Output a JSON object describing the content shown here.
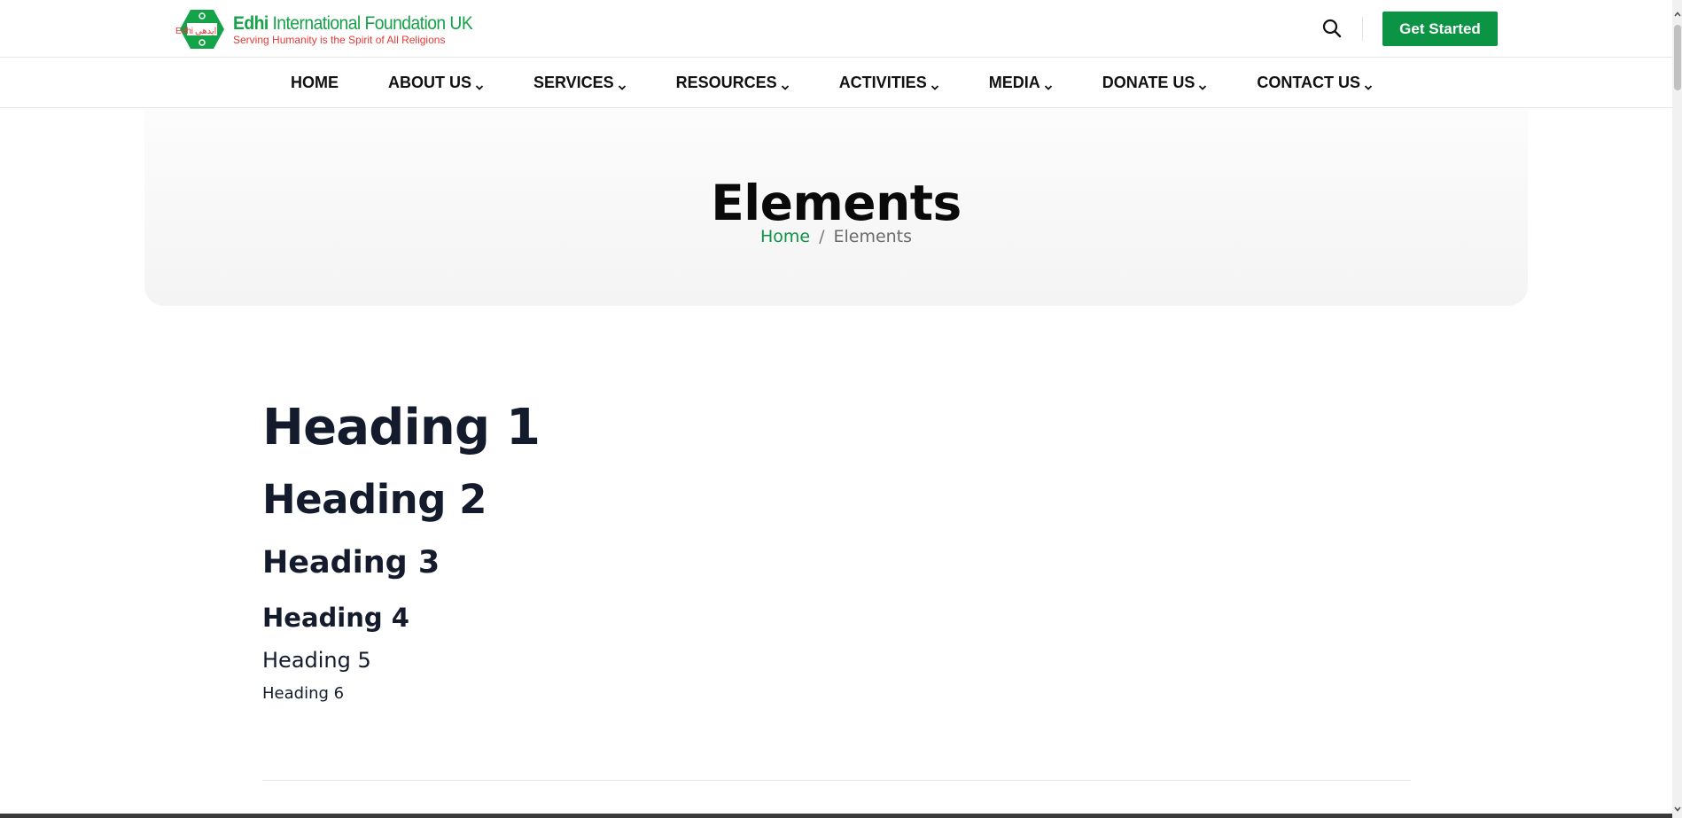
{
  "header": {
    "logo": {
      "mark_text": "Edhi ایدھی",
      "title_bold": "Edhi",
      "title_rest": " International Foundation UK",
      "tagline": "Serving Humanity is the Spirit of All Religions"
    },
    "search_icon": "search-icon",
    "cta_label": "Get Started"
  },
  "nav": {
    "items": [
      {
        "label": "HOME",
        "has_dropdown": false
      },
      {
        "label": "ABOUT US",
        "has_dropdown": true
      },
      {
        "label": "SERVICES",
        "has_dropdown": true
      },
      {
        "label": "RESOURCES",
        "has_dropdown": true
      },
      {
        "label": "ACTIVITIES",
        "has_dropdown": true
      },
      {
        "label": "MEDIA",
        "has_dropdown": true
      },
      {
        "label": "DONATE US",
        "has_dropdown": true
      },
      {
        "label": "CONTACT US",
        "has_dropdown": true
      }
    ]
  },
  "hero": {
    "title": "Elements",
    "breadcrumb": {
      "home": "Home",
      "separator": "/",
      "current": "Elements"
    }
  },
  "headings": {
    "h1": "Heading 1",
    "h2": "Heading 2",
    "h3": "Heading 3",
    "h4": "Heading 4",
    "h5": "Heading 5",
    "h6": "Heading 6"
  },
  "colors": {
    "brand_green": "#0b9444",
    "logo_green": "#15a34a",
    "logo_red": "#e53935",
    "text_dark": "#141b2d"
  }
}
